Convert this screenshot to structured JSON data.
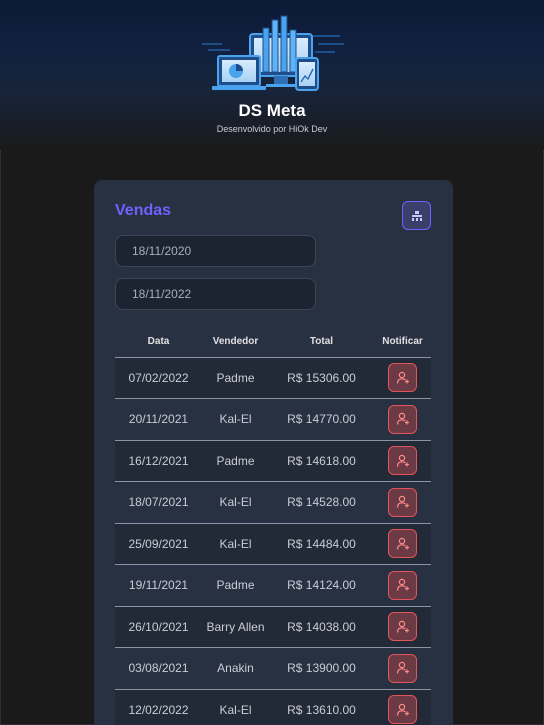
{
  "app": {
    "title": "DS Meta",
    "subtitle": "Desenvolvido por HiOk Dev",
    "logo_icon": "dashboard-devices-illustration"
  },
  "card": {
    "title": "Vendas",
    "filter_icon": "filter-icon"
  },
  "filters": {
    "min_date": "18/11/2020",
    "max_date": "18/11/2022"
  },
  "table": {
    "headers": [
      "Data",
      "Vendedor",
      "Total",
      "Notificar"
    ],
    "rows": [
      {
        "date": "07/02/2022",
        "seller": "Padme",
        "total": "R$ 15306.00"
      },
      {
        "date": "20/11/2021",
        "seller": "Kal-El",
        "total": "R$ 14770.00"
      },
      {
        "date": "16/12/2021",
        "seller": "Padme",
        "total": "R$ 14618.00"
      },
      {
        "date": "18/07/2021",
        "seller": "Kal-El",
        "total": "R$ 14528.00"
      },
      {
        "date": "25/09/2021",
        "seller": "Kal-El",
        "total": "R$ 14484.00"
      },
      {
        "date": "19/11/2021",
        "seller": "Padme",
        "total": "R$ 14124.00"
      },
      {
        "date": "26/10/2021",
        "seller": "Barry Allen",
        "total": "R$ 14038.00"
      },
      {
        "date": "03/08/2021",
        "seller": "Anakin",
        "total": "R$ 13900.00"
      },
      {
        "date": "12/02/2022",
        "seller": "Kal-El",
        "total": "R$ 13610.00"
      }
    ]
  },
  "colors": {
    "accent": "#6c63ff",
    "notify": "#e2555a",
    "card_bg": "#283142",
    "page_bg": "#1a1a1a"
  }
}
